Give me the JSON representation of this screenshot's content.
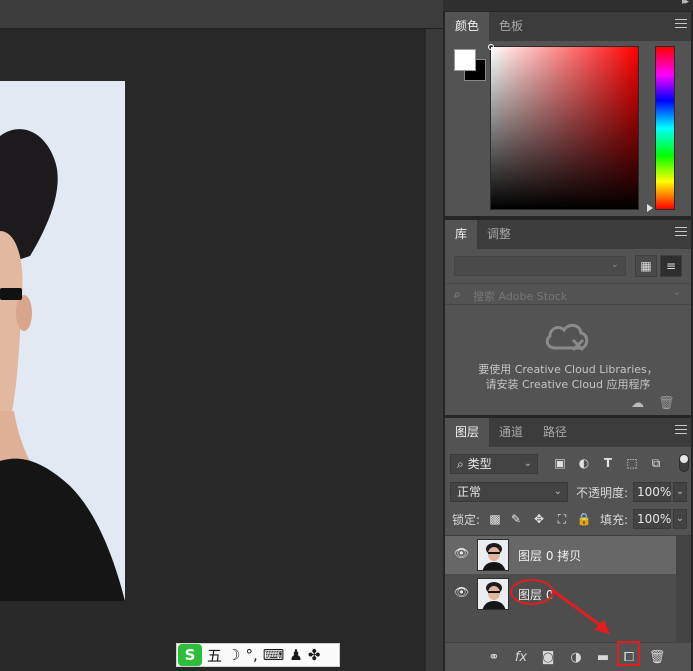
{
  "color_panel": {
    "tabs": [
      "颜色",
      "色板"
    ],
    "active_tab": "颜色",
    "foreground_color": "#ffffff",
    "background_color": "#000000",
    "hue": "#ff0000"
  },
  "library_panel": {
    "tabs": [
      "库",
      "调整"
    ],
    "active_tab": "库",
    "search_placeholder": "搜索 Adobe Stock",
    "message_line1": "要使用 Creative Cloud Libraries，",
    "message_line2": "请安装 Creative Cloud 应用程序"
  },
  "layers_panel": {
    "tabs": [
      "图层",
      "通道",
      "路径"
    ],
    "active_tab": "图层",
    "filter_kind": "类型",
    "blend_mode": "正常",
    "opacity_label": "不透明度:",
    "opacity_value": "100%",
    "lock_label": "锁定:",
    "fill_label": "填充:",
    "fill_value": "100%",
    "layers": [
      {
        "name": "图层 0 拷贝",
        "visible": true,
        "selected": true
      },
      {
        "name": "图层 0",
        "visible": true,
        "selected": false
      }
    ]
  },
  "ime": {
    "logo": "S",
    "mode": "五",
    "icons": [
      "moon-icon",
      "punct-icon",
      "keyboard-icon",
      "user-icon",
      "apps-icon"
    ]
  },
  "annotation_color": "#e51c1c"
}
